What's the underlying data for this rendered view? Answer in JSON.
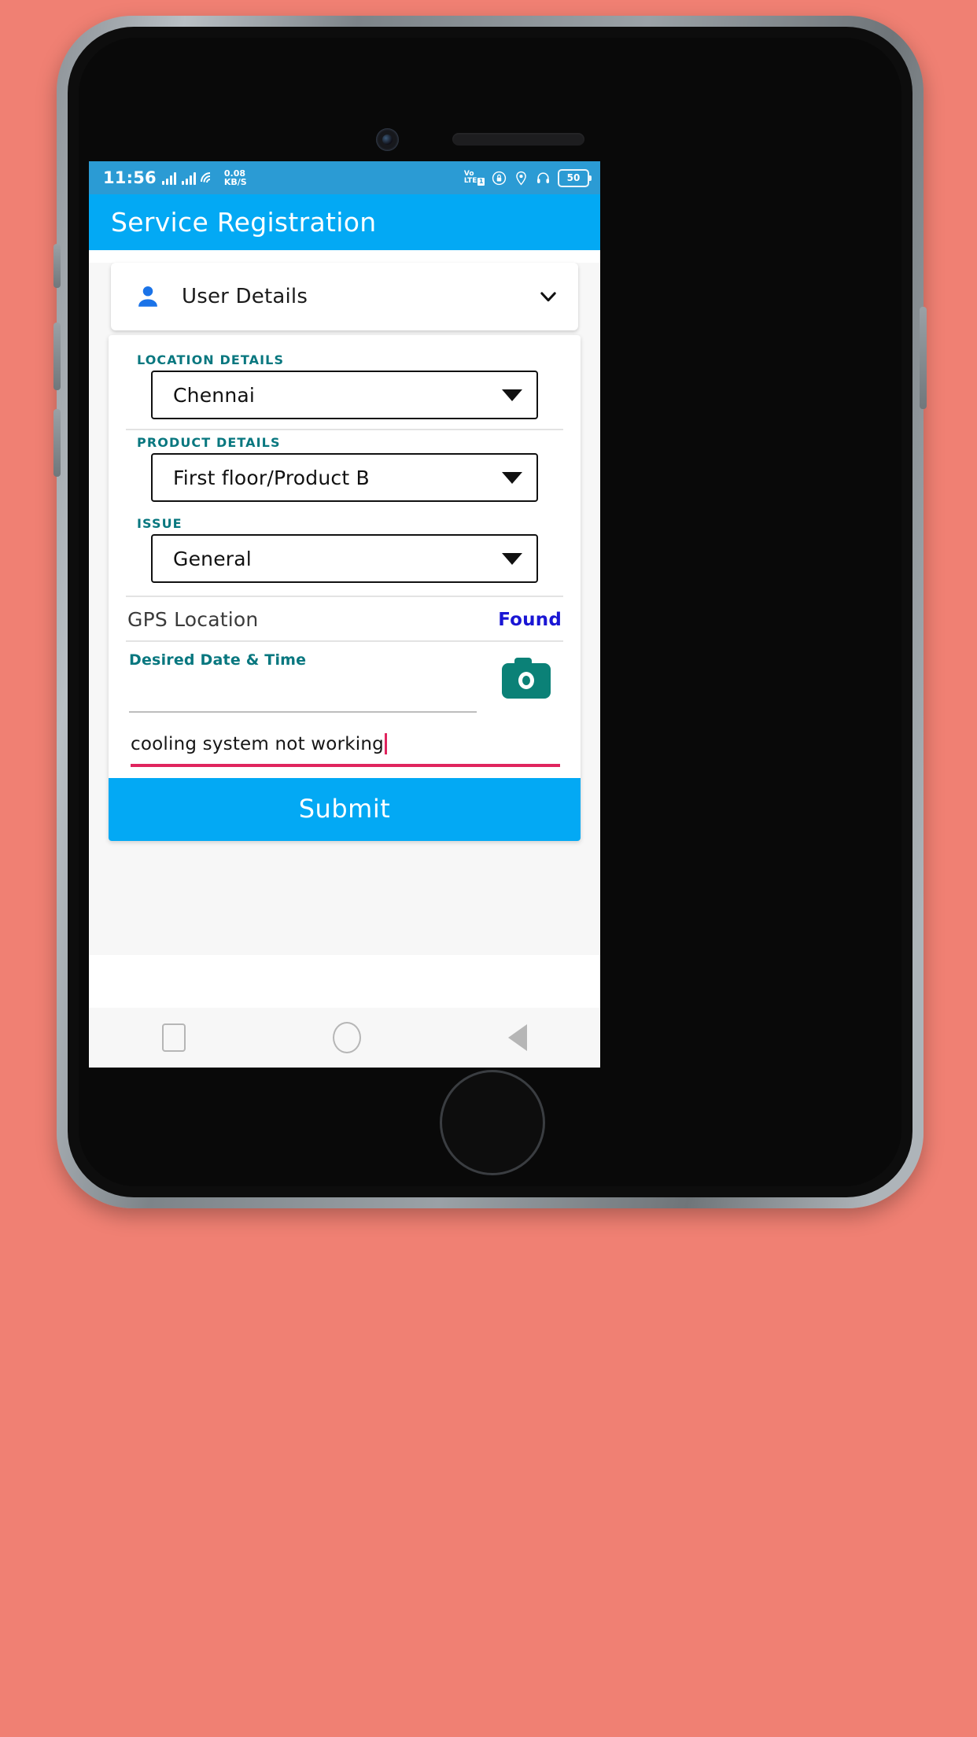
{
  "statusbar": {
    "time": "11:56",
    "network_speed_value": "0.08",
    "network_speed_unit": "KB/S",
    "volte_top": "Vo",
    "volte_bottom": "LTE",
    "volte_sim": "1",
    "battery_level": "50",
    "icons": [
      "signal-bars-icon",
      "signal-bars-icon",
      "wifi-icon",
      "rotation-lock-icon",
      "location-icon",
      "headset-icon",
      "battery-icon"
    ],
    "background_color": "#2b9bd4"
  },
  "appbar": {
    "title": "Service Registration",
    "background_color": "#03a9f4"
  },
  "user_card": {
    "label": "User Details",
    "icon": "person-icon",
    "expand_icon": "chevron-down-icon",
    "icon_color": "#1a73e8"
  },
  "form": {
    "label_color": "#08777f",
    "sections": [
      {
        "label": "LOCATION DETAILS",
        "value": "Chennai"
      },
      {
        "label": "PRODUCT DETAILS",
        "value": "First floor/Product B"
      },
      {
        "label": "ISSUE",
        "value": "General"
      }
    ],
    "gps": {
      "label": "GPS Location",
      "status": "Found",
      "status_color": "#1a16d4"
    },
    "date_time": {
      "label": "Desired Date & Time",
      "value": "",
      "camera_icon": "camera-icon",
      "camera_color": "#0b8177"
    },
    "note": {
      "value": "cooling system not working",
      "underline_color": "#e0245e"
    },
    "submit_label": "Submit"
  },
  "navbar": {
    "recent_icon": "recents-square-icon",
    "home_icon": "home-circle-icon",
    "back_icon": "back-triangle-icon"
  }
}
